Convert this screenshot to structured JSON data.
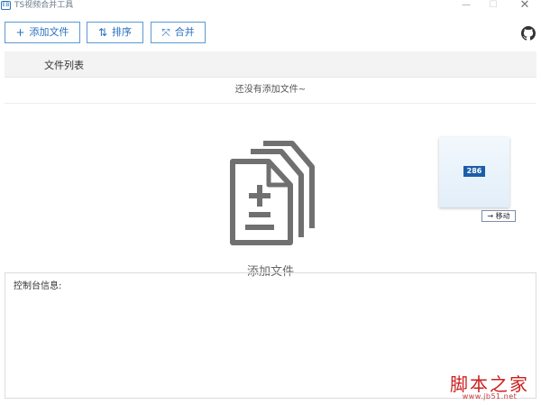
{
  "window": {
    "title": "TS视频合并工具",
    "icon_text": "EB",
    "min_symbol": "—",
    "max_symbol": "☐",
    "close_symbol": "✕"
  },
  "toolbar": {
    "add": {
      "label": "添加文件",
      "icon": "plus-icon",
      "glyph": "+"
    },
    "sort": {
      "label": "排序",
      "icon": "sort-icon",
      "glyph": "⇅"
    },
    "merge": {
      "label": "合并",
      "icon": "merge-icon",
      "glyph": "⤧"
    },
    "github_icon": "github-icon"
  },
  "file_list": {
    "header": "文件列表",
    "empty_message": "还没有添加文件~"
  },
  "drop_area": {
    "icon": "file-add-icon",
    "label": "添加文件"
  },
  "drag_preview": {
    "badge": "286",
    "tooltip": "→ 移动"
  },
  "console": {
    "label": "控制台信息:"
  },
  "watermark": {
    "brand": "脚本之家",
    "url": "www.jb51.net"
  },
  "colors": {
    "accent": "#2a6fbf",
    "button_border": "#5a9ad5",
    "icon_gray": "#707070",
    "watermark_red": "#cc1f1f"
  }
}
